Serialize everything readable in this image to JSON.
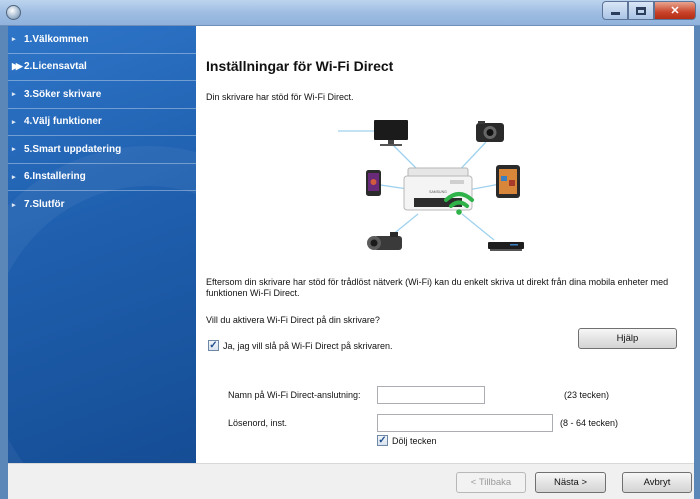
{
  "window": {
    "title": ""
  },
  "sidebar": {
    "items": [
      {
        "label": "1.Välkommen",
        "active": false
      },
      {
        "label": "2.Licensavtal",
        "active": true
      },
      {
        "label": "3.Söker skrivare",
        "active": false
      },
      {
        "label": "4.Välj funktioner",
        "active": false
      },
      {
        "label": "5.Smart uppdatering",
        "active": false
      },
      {
        "label": "6.Installering",
        "active": false
      },
      {
        "label": "7.Slutför",
        "active": false
      }
    ]
  },
  "main": {
    "title": "Inställningar för Wi-Fi Direct",
    "subtitle": "Din skrivare har stöd för Wi-Fi Direct.",
    "illustration_brand": "SAMSUNG",
    "description": "Eftersom din skrivare har stöd för trådlöst nätverk (Wi-Fi) kan du enkelt skriva ut direkt från dina mobila enheter med funktionen Wi-Fi Direct.",
    "question": "Vill du aktivera Wi-Fi Direct på din skrivare?",
    "enable_checkbox": {
      "label": "Ja, jag vill slå på Wi-Fi Direct på skrivaren.",
      "checked": true
    },
    "help_button": "Hjälp",
    "name_field": {
      "label": "Namn på Wi-Fi Direct-anslutning:",
      "value": "",
      "hint": "(23 tecken)"
    },
    "password_field": {
      "label": "Lösenord, inst.",
      "value": "",
      "hint": "(8 - 64 tecken)"
    },
    "hide_checkbox": {
      "label": "Dölj tecken",
      "checked": true
    }
  },
  "footer": {
    "back_button": "< Tillbaka",
    "next_button": "Nästa >",
    "cancel_button": "Avbryt"
  },
  "colors": {
    "sidebar": "#1f5fae",
    "titlebar": "#9fbde2",
    "close": "#c9432a",
    "wifi": "#2fb24a"
  }
}
